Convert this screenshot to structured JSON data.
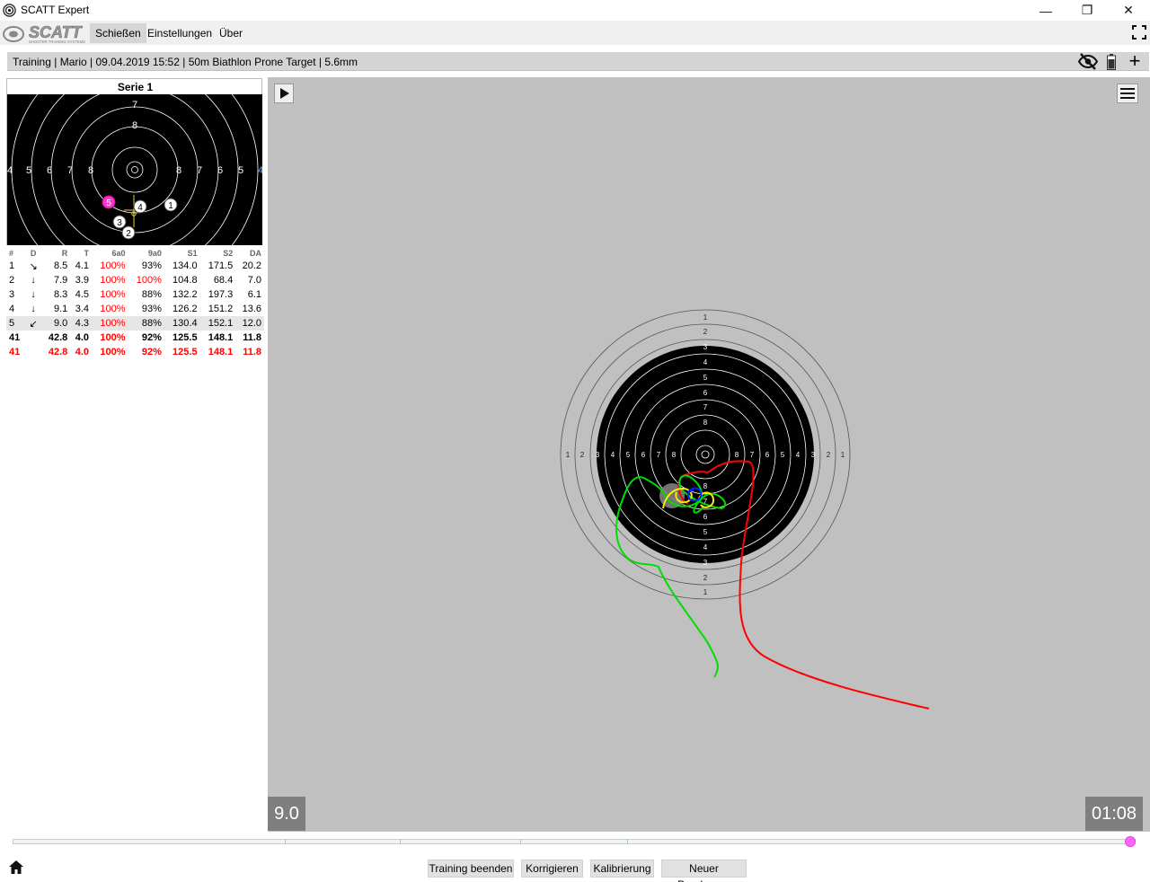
{
  "window": {
    "title": "SCATT Expert",
    "minimize": "—",
    "maximize": "❐",
    "close": "✕"
  },
  "brand": {
    "name": "SCATT",
    "tagline": "SHOOTER TRAINING SYSTEMS"
  },
  "menu": {
    "items": [
      "Schießen",
      "Einstellungen",
      "Über"
    ],
    "active": 0
  },
  "info": {
    "text": "Training | Mario | 09.04.2019 15:52 | 50m Biathlon Prone Target | 5.6mm"
  },
  "series": {
    "title": "Serie 1",
    "ring_labels": [
      "4",
      "5",
      "6",
      "7",
      "8"
    ],
    "shots": [
      {
        "num": "1",
        "color": "#ffffff"
      },
      {
        "num": "2",
        "color": "#ffffff"
      },
      {
        "num": "3",
        "color": "#ffffff"
      },
      {
        "num": "4",
        "color": "#ffffff"
      },
      {
        "num": "5",
        "color": "#ff33cc"
      }
    ]
  },
  "table": {
    "headers": [
      "#",
      "D",
      "R",
      "T",
      "6a0",
      "9a0",
      "S1",
      "S2",
      "DA"
    ],
    "rows": [
      [
        "1",
        "↘",
        "8.5",
        "4.1",
        "100%",
        "93%",
        "134.0",
        "171.5",
        "20.2"
      ],
      [
        "2",
        "↓",
        "7.9",
        "3.9",
        "100%",
        "100%",
        "104.8",
        "68.4",
        "7.0"
      ],
      [
        "3",
        "↓",
        "8.3",
        "4.5",
        "100%",
        "88%",
        "132.2",
        "197.3",
        "6.1"
      ],
      [
        "4",
        "↓",
        "9.1",
        "3.4",
        "100%",
        "93%",
        "126.2",
        "151.2",
        "13.6"
      ],
      [
        "5",
        "↙",
        "9.0",
        "4.3",
        "100%",
        "88%",
        "130.4",
        "152.1",
        "12.0"
      ]
    ],
    "red_cells": [
      [
        0,
        4
      ],
      [
        1,
        4
      ],
      [
        1,
        5
      ],
      [
        2,
        4
      ],
      [
        3,
        4
      ],
      [
        4,
        4
      ]
    ],
    "selected_row": 4,
    "total": [
      "41",
      "",
      "42.8",
      "4.0",
      "100%",
      "92%",
      "125.5",
      "148.1",
      "11.8"
    ],
    "average": [
      "41",
      "",
      "42.8",
      "4.0",
      "100%",
      "92%",
      "125.5",
      "148.1",
      "11.8"
    ]
  },
  "main_target": {
    "ring_labels": [
      "1",
      "2",
      "3",
      "4",
      "5",
      "6",
      "7",
      "8"
    ],
    "trace_colors": {
      "before": "#00dd00",
      "aim": "#ffff00",
      "shot": "#0000ff",
      "after": "#ff0000"
    }
  },
  "overlays": {
    "score": "9.0",
    "time": "01:08"
  },
  "timeline": {
    "position": 0.995,
    "ticks": [
      0.243,
      0.345,
      0.452,
      0.547
    ]
  },
  "buttons": {
    "end_training": "Training beenden",
    "correct": "Korrigieren",
    "calibrate": "Kalibrierung",
    "new_round": "Neuer Durchgang"
  }
}
